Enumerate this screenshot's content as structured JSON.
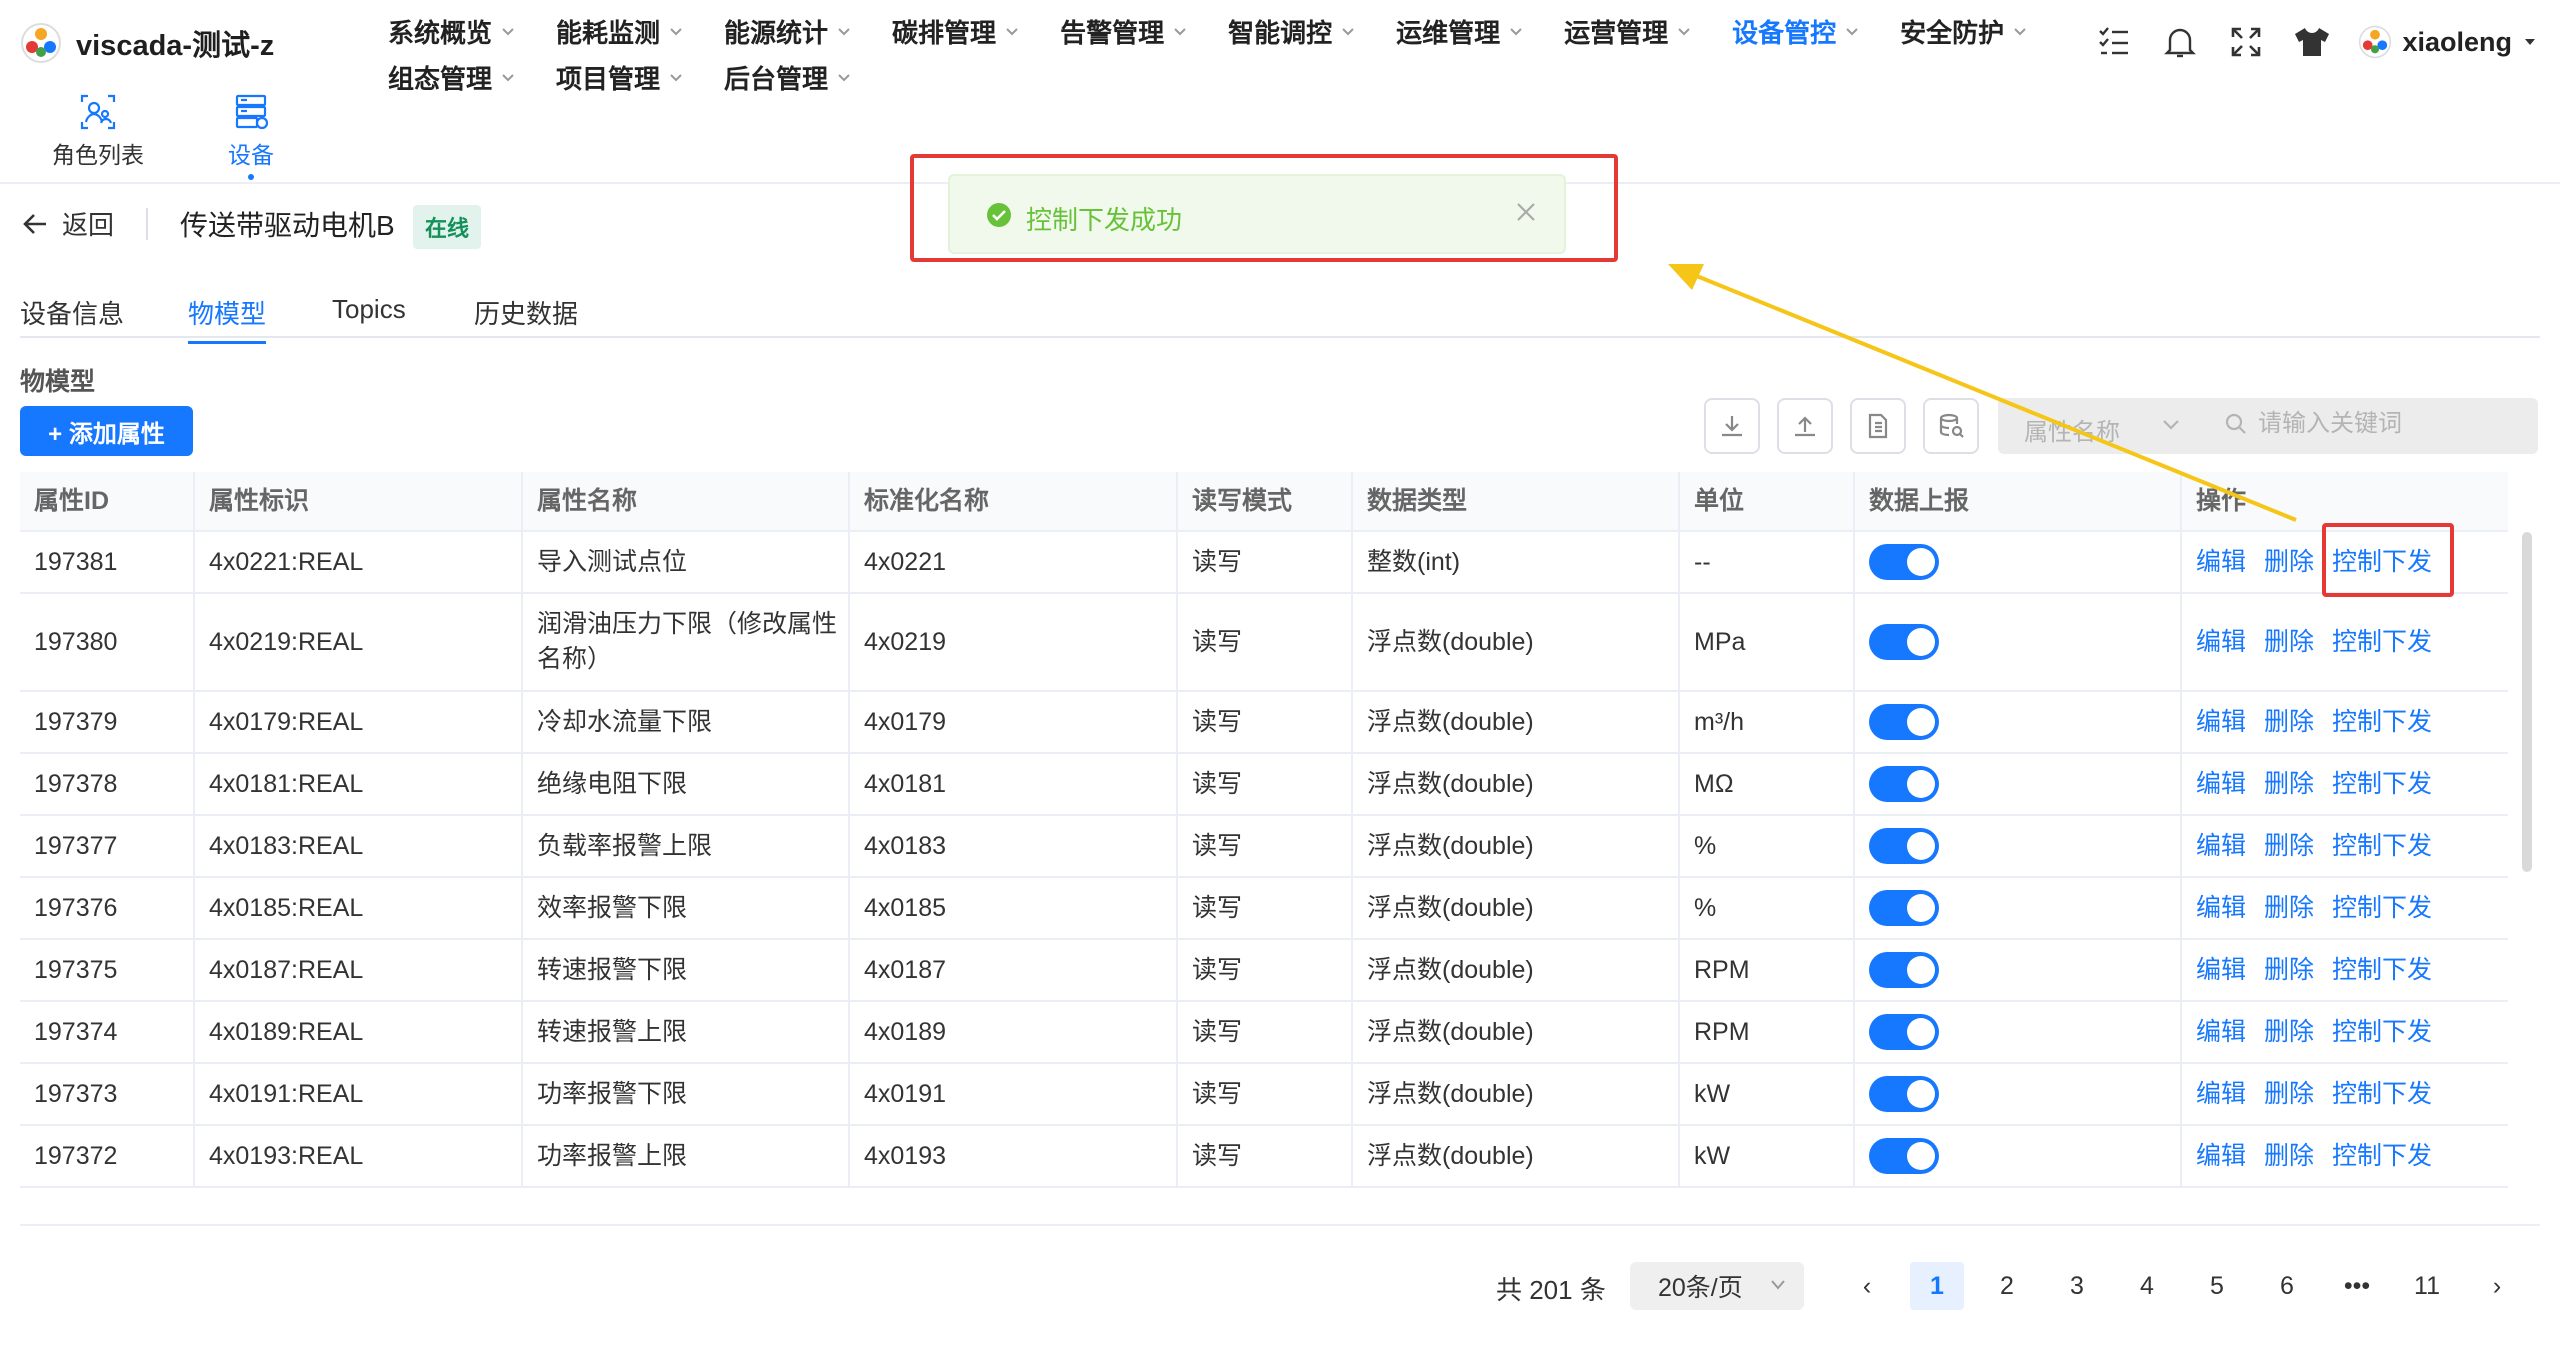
{
  "app": {
    "title": "viscada-测试-z",
    "user": "xiaoleng"
  },
  "nav": {
    "row1": [
      {
        "label": "系统概览",
        "active": false
      },
      {
        "label": "能耗监测",
        "active": false
      },
      {
        "label": "能源统计",
        "active": false
      },
      {
        "label": "碳排管理",
        "active": false
      },
      {
        "label": "告警管理",
        "active": false
      },
      {
        "label": "智能调控",
        "active": false
      },
      {
        "label": "运维管理",
        "active": false
      },
      {
        "label": "运营管理",
        "active": false
      },
      {
        "label": "设备管控",
        "active": true
      },
      {
        "label": "安全防护",
        "active": false
      }
    ],
    "row2": [
      {
        "label": "组态管理",
        "active": false
      },
      {
        "label": "项目管理",
        "active": false
      },
      {
        "label": "后台管理",
        "active": false
      }
    ]
  },
  "quick_links": [
    {
      "label": "角色列表",
      "icon": "role-list-icon",
      "active": false
    },
    {
      "label": "设备",
      "icon": "device-icon",
      "active": true
    }
  ],
  "page": {
    "back_label": "返回",
    "device_name": "传送带驱动电机B",
    "status": "在线",
    "tabs": [
      "设备信息",
      "物模型",
      "Topics",
      "历史数据"
    ],
    "active_tab": "物模型",
    "section_title": "物模型",
    "add_button": "+ 添加属性"
  },
  "filter": {
    "select_placeholder": "属性名称",
    "search_placeholder": "请输入关键词"
  },
  "table": {
    "headers": [
      "属性ID",
      "属性标识",
      "属性名称",
      "标准化名称",
      "读写模式",
      "数据类型",
      "单位",
      "数据上报",
      "操作"
    ],
    "actions": [
      "编辑",
      "删除",
      "控制下发"
    ],
    "rows": [
      {
        "id": "197381",
        "ident": "4x0221:REAL",
        "name": "导入测试点位",
        "std": "4x0221",
        "rw": "读写",
        "type": "整数(int)",
        "unit": "--",
        "report": true
      },
      {
        "id": "197380",
        "ident": "4x0219:REAL",
        "name": "润滑油压力下限（修改属性名称）",
        "std": "4x0219",
        "rw": "读写",
        "type": "浮点数(double)",
        "unit": "MPa",
        "report": true
      },
      {
        "id": "197379",
        "ident": "4x0179:REAL",
        "name": "冷却水流量下限",
        "std": "4x0179",
        "rw": "读写",
        "type": "浮点数(double)",
        "unit": "m³/h",
        "report": true
      },
      {
        "id": "197378",
        "ident": "4x0181:REAL",
        "name": "绝缘电阻下限",
        "std": "4x0181",
        "rw": "读写",
        "type": "浮点数(double)",
        "unit": "MΩ",
        "report": true
      },
      {
        "id": "197377",
        "ident": "4x0183:REAL",
        "name": "负载率报警上限",
        "std": "4x0183",
        "rw": "读写",
        "type": "浮点数(double)",
        "unit": "%",
        "report": true
      },
      {
        "id": "197376",
        "ident": "4x0185:REAL",
        "name": "效率报警下限",
        "std": "4x0185",
        "rw": "读写",
        "type": "浮点数(double)",
        "unit": "%",
        "report": true
      },
      {
        "id": "197375",
        "ident": "4x0187:REAL",
        "name": "转速报警下限",
        "std": "4x0187",
        "rw": "读写",
        "type": "浮点数(double)",
        "unit": "RPM",
        "report": true
      },
      {
        "id": "197374",
        "ident": "4x0189:REAL",
        "name": "转速报警上限",
        "std": "4x0189",
        "rw": "读写",
        "type": "浮点数(double)",
        "unit": "RPM",
        "report": true
      },
      {
        "id": "197373",
        "ident": "4x0191:REAL",
        "name": "功率报警下限",
        "std": "4x0191",
        "rw": "读写",
        "type": "浮点数(double)",
        "unit": "kW",
        "report": true
      },
      {
        "id": "197372",
        "ident": "4x0193:REAL",
        "name": "功率报警上限",
        "std": "4x0193",
        "rw": "读写",
        "type": "浮点数(double)",
        "unit": "kW",
        "report": true
      }
    ]
  },
  "pagination": {
    "total": "共 201 条",
    "page_size": "20条/页",
    "pages": [
      "1",
      "2",
      "3",
      "4",
      "5",
      "6",
      "•••",
      "11"
    ],
    "current": "1",
    "prev": "‹",
    "next": "›"
  },
  "toast": {
    "message": "控制下发成功"
  },
  "colors": {
    "primary": "#1677ff",
    "success": "#67c23a",
    "annotation": "#e53935",
    "arrow": "#f5c518"
  }
}
